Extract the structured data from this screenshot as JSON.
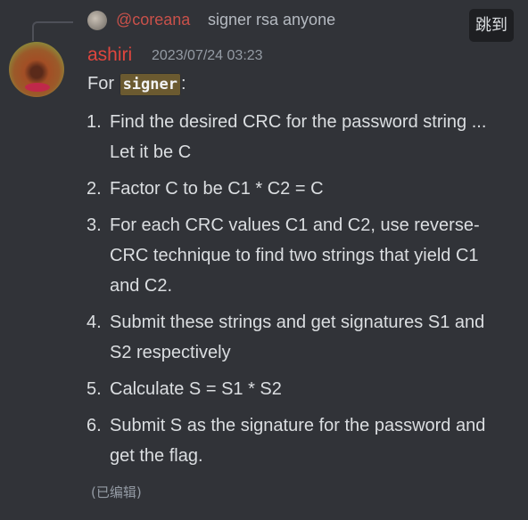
{
  "reply": {
    "mention": "@coreana",
    "text": "signer rsa anyone",
    "jump_label": "跳到"
  },
  "message": {
    "author": "ashiri",
    "author_color": "#e0463e",
    "timestamp": "2023/07/24 03:23",
    "intro_prefix": "For",
    "intro_code": "signer",
    "intro_suffix": ":",
    "items": [
      {
        "num": "1.",
        "text": "Find the desired CRC for the password string ...  Let it be C"
      },
      {
        "num": "2.",
        "text": "Factor C to be C1 * C2 = C"
      },
      {
        "num": "3.",
        "text": "For each CRC values C1 and C2, use reverse-CRC  technique to find two strings that yield C1 and C2."
      },
      {
        "num": "4.",
        "text": "Submit these strings and get signatures S1 and S2 respectively"
      },
      {
        "num": "5.",
        "text": "Calculate S = S1 * S2"
      },
      {
        "num": "6.",
        "text": "Submit S as the signature for the password and get the flag."
      }
    ],
    "edited": "(已编辑)"
  }
}
